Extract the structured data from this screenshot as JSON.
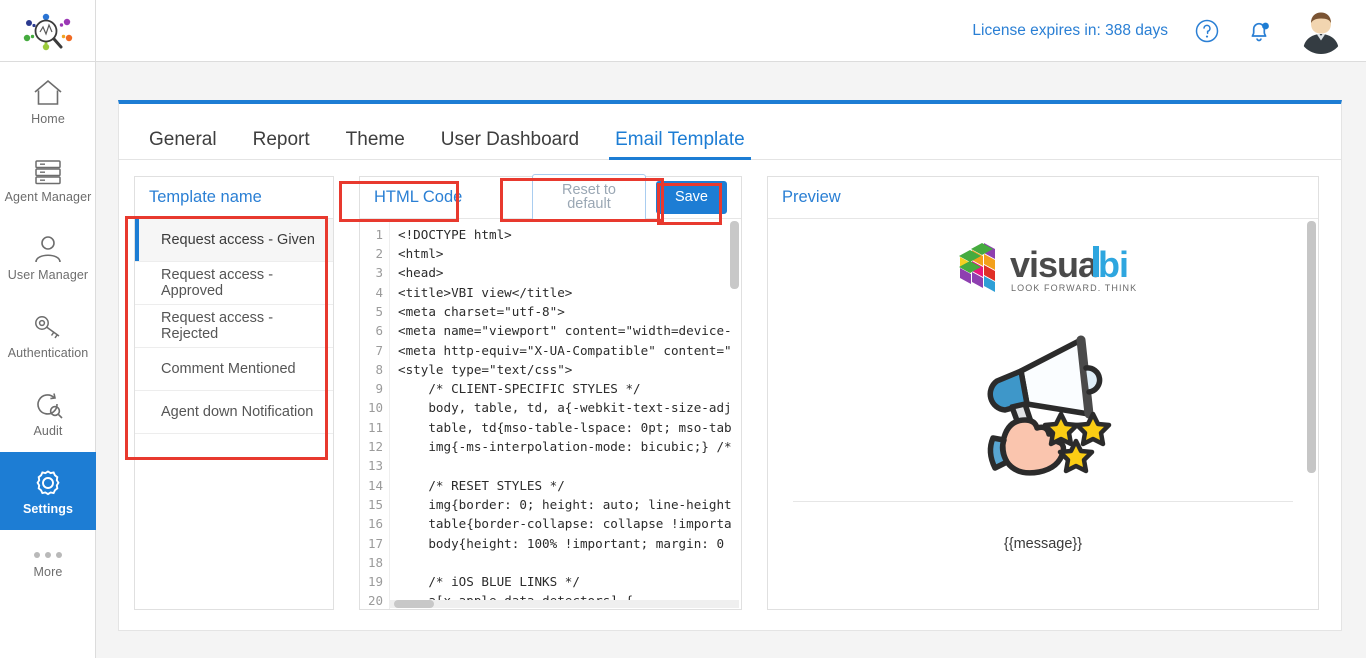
{
  "brand": {
    "logo_name": "analytics-magnifier-logo"
  },
  "sidebar": {
    "items": [
      {
        "label": "Home",
        "icon": "home-icon",
        "active": false
      },
      {
        "label": "Agent Manager",
        "icon": "server-stack-icon",
        "active": false
      },
      {
        "label": "User Manager",
        "icon": "user-icon",
        "active": false
      },
      {
        "label": "Authentication",
        "icon": "key-icon",
        "active": false
      },
      {
        "label": "Audit",
        "icon": "audit-search-icon",
        "active": false
      },
      {
        "label": "Settings",
        "icon": "gear-icon",
        "active": true
      }
    ],
    "more_label": "More"
  },
  "topbar": {
    "license_text": "License expires in: 388 days",
    "help_icon": "help-circle-icon",
    "notification_icon": "bell-icon",
    "notification_badge": true,
    "avatar_icon": "user-avatar"
  },
  "tabs": [
    {
      "label": "General",
      "active": false
    },
    {
      "label": "Report",
      "active": false
    },
    {
      "label": "Theme",
      "active": false
    },
    {
      "label": "User Dashboard",
      "active": false
    },
    {
      "label": "Email Template",
      "active": true
    }
  ],
  "panels": {
    "template_list": {
      "title": "Template name",
      "items": [
        {
          "label": "Request access - Given",
          "active": true
        },
        {
          "label": "Request access - Approved",
          "active": false
        },
        {
          "label": "Request access - Rejected",
          "active": false
        },
        {
          "label": "Comment Mentioned",
          "active": false
        },
        {
          "label": "Agent down Notification",
          "active": false
        }
      ]
    },
    "html_code": {
      "title": "HTML Code",
      "reset_label": "Reset to default",
      "save_label": "Save",
      "lines": [
        "<!DOCTYPE html>",
        "<html>",
        "<head>",
        "<title>VBI view</title>",
        "<meta charset=\"utf-8\">",
        "<meta name=\"viewport\" content=\"width=device-",
        "<meta http-equiv=\"X-UA-Compatible\" content=\"",
        "<style type=\"text/css\">",
        "    /* CLIENT-SPECIFIC STYLES */",
        "    body, table, td, a{-webkit-text-size-adj",
        "    table, td{mso-table-lspace: 0pt; mso-tab",
        "    img{-ms-interpolation-mode: bicubic;} /*",
        "",
        "    /* RESET STYLES */",
        "    img{border: 0; height: auto; line-height",
        "    table{border-collapse: collapse !importa",
        "    body{height: 100% !important; margin: 0",
        "",
        "    /* iOS BLUE LINKS */",
        "    a[x-apple-data-detectors] {"
      ],
      "line_numbers": [
        1,
        2,
        3,
        4,
        5,
        6,
        7,
        8,
        9,
        10,
        11,
        12,
        13,
        14,
        15,
        16,
        17,
        18,
        19,
        20
      ]
    },
    "preview": {
      "title": "Preview",
      "logo_word_dark": "visual",
      "logo_word_light": "bi",
      "logo_tagline": "LOOK FORWARD. THINK AHEAD.",
      "hero_icon": "megaphone-with-stars-illustration",
      "message_placeholder": "{{message}}"
    }
  },
  "annotations": {
    "color": "#e8392e",
    "boxes": [
      {
        "name": "template-list-highlight"
      },
      {
        "name": "html-code-title-highlight"
      },
      {
        "name": "reset-button-highlight"
      },
      {
        "name": "save-button-highlight"
      }
    ]
  },
  "colors": {
    "accent": "#1d7dd4",
    "link": "#2a7fd4",
    "page_bg": "#f4f4f4",
    "annotation": "#e8392e"
  }
}
